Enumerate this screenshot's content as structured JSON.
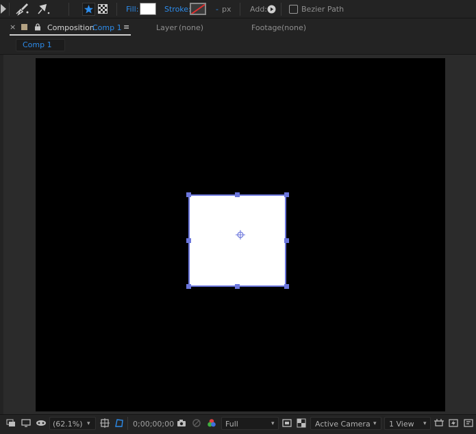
{
  "toolbar": {
    "fill_label": "Fill:",
    "stroke_label": "Stroke:",
    "stroke_width_value": "-",
    "stroke_width_unit": "px",
    "add_label": "Add:",
    "bezier_label": "Bezier Path",
    "fill_color": "#ffffff"
  },
  "panel_tabs": {
    "close_glyph": "×",
    "composition_label": "Composition",
    "composition_name": "Comp 1",
    "menu_glyph": "≡",
    "layer_label": "Layer",
    "layer_value": "(none)",
    "footage_label": "Footage",
    "footage_value": "(none)"
  },
  "comp_tab": {
    "label": "Comp 1"
  },
  "bottom_bar": {
    "zoom": "(62.1%)",
    "timecode": "0;00;00;00",
    "resolution": "Full",
    "camera": "Active Camera",
    "views": "1 View"
  },
  "colors": {
    "accent": "#2d8ceb",
    "selection": "#6b76dc",
    "canvas": "#000000",
    "shape_fill": "#ffffff"
  }
}
